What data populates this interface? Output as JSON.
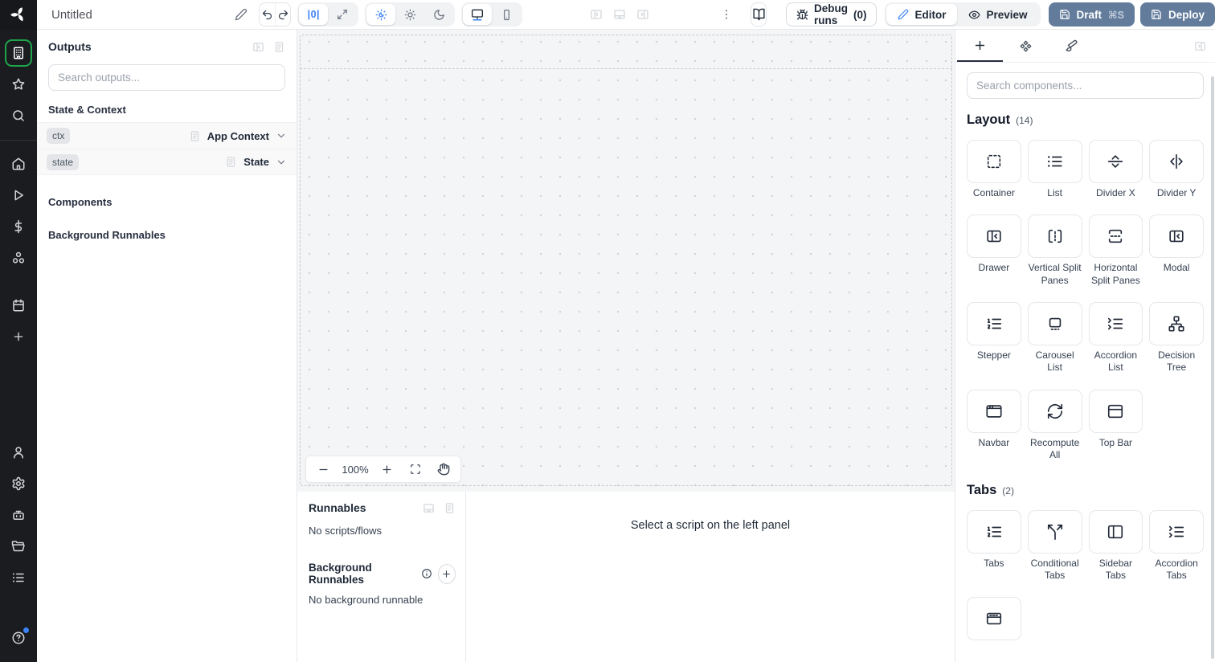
{
  "topbar": {
    "title": "Untitled",
    "zero_pad_label": "|0|",
    "debug_runs_label": "Debug runs",
    "debug_runs_count": "(0)",
    "editor_label": "Editor",
    "preview_label": "Preview",
    "draft_label": "Draft",
    "draft_shortcut": "⌘S",
    "deploy_label": "Deploy"
  },
  "outputs_panel": {
    "title": "Outputs",
    "search_placeholder": "Search outputs...",
    "state_context_heading": "State & Context",
    "rows": [
      {
        "badge": "ctx",
        "type": "App Context"
      },
      {
        "badge": "state",
        "type": "State"
      }
    ],
    "components_heading": "Components",
    "background_runnables_heading": "Background Runnables"
  },
  "canvas": {
    "zoom_level": "100%"
  },
  "runnables_panel": {
    "title": "Runnables",
    "empty_text": "No scripts/flows",
    "background_title": "Background Runnables",
    "background_empty_text": "No background runnable",
    "hint_text": "Select a script on the left panel"
  },
  "components_panel": {
    "search_placeholder": "Search components...",
    "sections": [
      {
        "title": "Layout",
        "count": "(14)",
        "items": [
          {
            "label": "Container",
            "icon": "container-icon"
          },
          {
            "label": "List",
            "icon": "list-icon"
          },
          {
            "label": "Divider X",
            "icon": "divider-x-icon"
          },
          {
            "label": "Divider Y",
            "icon": "divider-y-icon"
          },
          {
            "label": "Drawer",
            "icon": "drawer-icon"
          },
          {
            "label": "Vertical Split Panes",
            "icon": "vertical-split-icon"
          },
          {
            "label": "Horizontal Split Panes",
            "icon": "horizontal-split-icon"
          },
          {
            "label": "Modal",
            "icon": "modal-icon"
          },
          {
            "label": "Stepper",
            "icon": "ordered-list-icon"
          },
          {
            "label": "Carousel List",
            "icon": "carousel-icon"
          },
          {
            "label": "Accordion List",
            "icon": "accordion-icon"
          },
          {
            "label": "Decision Tree",
            "icon": "decision-tree-icon"
          },
          {
            "label": "Navbar",
            "icon": "navbar-icon"
          },
          {
            "label": "Recompute All",
            "icon": "recompute-icon"
          },
          {
            "label": "Top Bar",
            "icon": "top-bar-icon"
          }
        ]
      },
      {
        "title": "Tabs",
        "count": "(2)",
        "items": [
          {
            "label": "Tabs",
            "icon": "ordered-list-icon"
          },
          {
            "label": "Conditional Tabs",
            "icon": "conditional-tabs-icon"
          },
          {
            "label": "Sidebar Tabs",
            "icon": "sidebar-tabs-icon"
          },
          {
            "label": "Accordion Tabs",
            "icon": "accordion-icon"
          },
          {
            "label": "",
            "icon": "invisible-tabs-icon"
          }
        ]
      }
    ]
  },
  "colors": {
    "accent_blue": "#3b82f6",
    "active_green": "#1ea54c",
    "primary_button": "#637c9c",
    "rail_background": "#1b1c20",
    "canvas_background": "#f4f5f6"
  }
}
